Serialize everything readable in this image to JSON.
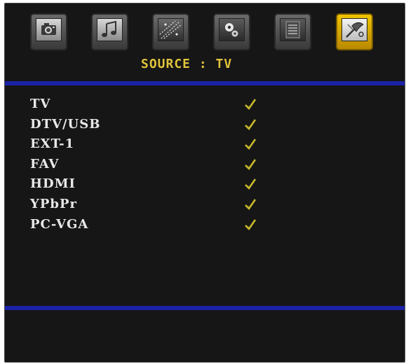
{
  "menu": {
    "tabs": [
      {
        "icon": "camera-icon",
        "active": false
      },
      {
        "icon": "music-note-icon",
        "active": false
      },
      {
        "icon": "sparkle-picture-icon",
        "active": false
      },
      {
        "icon": "gears-icon",
        "active": false
      },
      {
        "icon": "document-list-icon",
        "active": false
      },
      {
        "icon": "satellite-tools-icon",
        "active": true
      }
    ]
  },
  "header": {
    "title": "SOURCE : TV"
  },
  "sources": [
    {
      "label": "TV",
      "enabled": true
    },
    {
      "label": "DTV/USB",
      "enabled": true
    },
    {
      "label": "EXT-1",
      "enabled": true
    },
    {
      "label": "FAV",
      "enabled": true
    },
    {
      "label": "HDMI",
      "enabled": true
    },
    {
      "label": "YPbPr",
      "enabled": true
    },
    {
      "label": "PC-VGA",
      "enabled": true
    }
  ],
  "colors": {
    "background": "#161616",
    "accent_band": "#1b22a8",
    "title": "#e0c33a",
    "check": "#c9b92a",
    "active_tab": "#f0c400"
  }
}
